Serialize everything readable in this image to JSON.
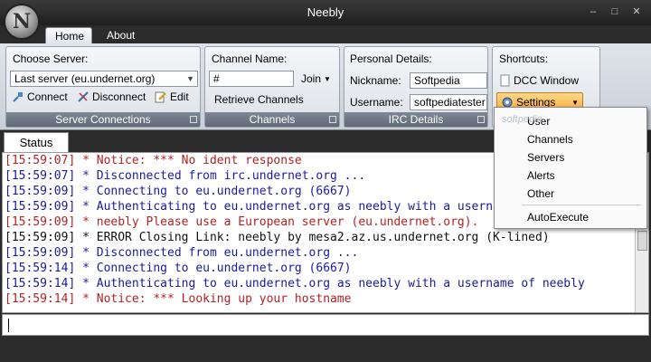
{
  "window": {
    "title": "Neebly",
    "logo_letter": "N",
    "minimize": "–",
    "maximize": "□",
    "close": "✕"
  },
  "ribbon_tabs": [
    "Home",
    "About"
  ],
  "server_group": {
    "label": "Choose Server:",
    "selected": "Last server (eu.undernet.org)",
    "connect": "Connect",
    "disconnect": "Disconnect",
    "edit": "Edit",
    "footer": "Server Connections"
  },
  "channels_group": {
    "label": "Channel Name:",
    "value": "#",
    "join": "Join",
    "retrieve": "Retrieve Channels",
    "footer": "Channels"
  },
  "irc_group": {
    "label": "Personal Details:",
    "nickname_label": "Nickname:",
    "nickname": "Softpedia",
    "username_label": "Username:",
    "username": "softpediatester",
    "footer": "IRC Details"
  },
  "shortcuts_group": {
    "label": "Shortcuts:",
    "dcc": "DCC Window",
    "settings": "Settings"
  },
  "settings_menu": [
    "User",
    "Channels",
    "Servers",
    "Alerts",
    "Other",
    "AutoExecute"
  ],
  "watermark": "softpedia",
  "status_tab": "Status",
  "log_lines": [
    {
      "text": "[15:59:07] * Notice: *** No ident response",
      "color": "#b22222"
    },
    {
      "text": "[15:59:07] * Disconnected from irc.undernet.org ...",
      "color": "#1a1a9a"
    },
    {
      "text": "[15:59:09] * Connecting to eu.undernet.org (6667)",
      "color": "#1a1a9a"
    },
    {
      "text": "[15:59:09] * Authenticating to eu.undernet.org as neebly with a usernam",
      "color": "#1a1a9a"
    },
    {
      "text": "[15:59:09] * neebly Please use a European server (eu.undernet.org).",
      "color": "#b22222"
    },
    {
      "text": "[15:59:09] * ERROR Closing Link: neebly by mesa2.az.us.undernet.org (K-lined)",
      "color": "#111111"
    },
    {
      "text": "[15:59:09] * Disconnected from eu.undernet.org ...",
      "color": "#1a1a9a"
    },
    {
      "text": "[15:59:14] * Connecting to eu.undernet.org (6667)",
      "color": "#1a1a9a"
    },
    {
      "text": "[15:59:14] * Authenticating to eu.undernet.org as neebly with a username of neebly",
      "color": "#1a1a9a"
    },
    {
      "text": "[15:59:14] * Notice: *** Looking up your hostname",
      "color": "#b22222"
    }
  ]
}
